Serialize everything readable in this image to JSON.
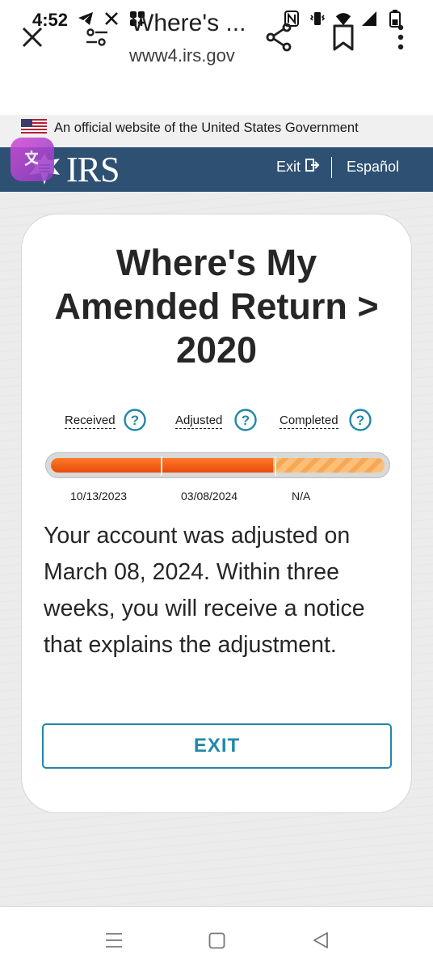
{
  "status_bar": {
    "time": "4:52",
    "left_icons": [
      "telegram-icon",
      "x-icon",
      "app-grid-icon"
    ],
    "right_icons": [
      "nfc-icon",
      "vibrate-icon",
      "wifi-icon",
      "signal-icon",
      "battery-icon"
    ]
  },
  "browser": {
    "page_title": "Where's ...",
    "url": "www4.irs.gov"
  },
  "gov_banner": {
    "text": "An official website of the United States Government"
  },
  "header": {
    "logo_text": "IRS",
    "exit_label": "Exit",
    "espanol_label": "Español"
  },
  "card": {
    "title_line1": "Where's My",
    "title_line2": "Amended Return >",
    "title_line3": "2020",
    "steps": [
      {
        "label": "Received",
        "date": "10/13/2023",
        "status": "done"
      },
      {
        "label": "Adjusted",
        "date": "03/08/2024",
        "status": "done"
      },
      {
        "label": "Completed",
        "date": "N/A",
        "status": "pending"
      }
    ],
    "progress_completed_fraction": 0.667,
    "message": "Your account was adjusted on March 08, 2024. Within three weeks, you will receive a notice that explains the adjustment.",
    "exit_button_label": "EXIT"
  },
  "colors": {
    "irs_blue": "#2e5073",
    "progress_done": "#e84a0a",
    "progress_pending": "#f7a857",
    "accent_teal": "#1f88a8"
  }
}
